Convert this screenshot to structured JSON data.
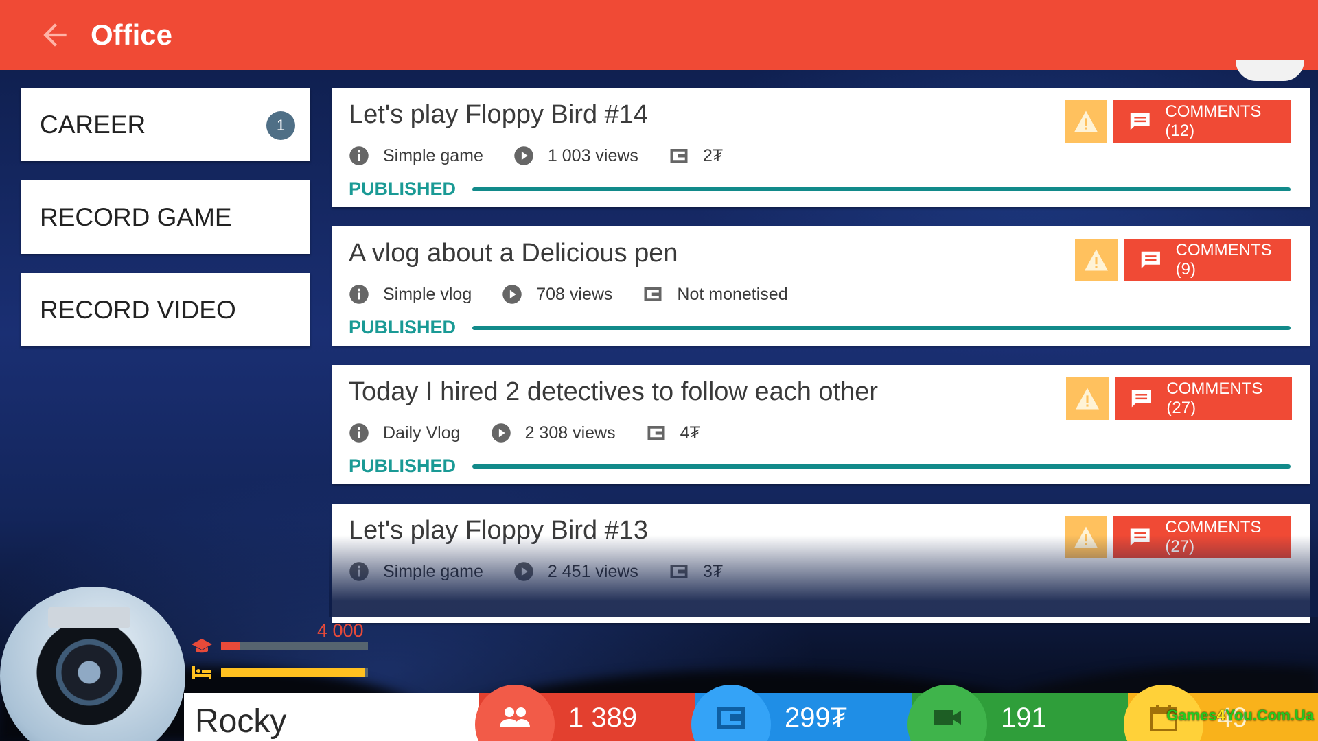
{
  "header": {
    "title": "Office"
  },
  "menu": {
    "items": [
      {
        "label": "CAREER",
        "badge": "1"
      },
      {
        "label": "RECORD GAME"
      },
      {
        "label": "RECORD VIDEO"
      }
    ]
  },
  "videos": [
    {
      "title": "Let's play Floppy Bird #14",
      "category": "Simple game",
      "views": "1 003 views",
      "earnings": "2₮",
      "status": "PUBLISHED",
      "comments": "COMMENTS (12)"
    },
    {
      "title": "A vlog about a Delicious pen",
      "category": "Simple vlog",
      "views": "708 views",
      "earnings": "Not monetised",
      "status": "PUBLISHED",
      "comments": "COMMENTS (9)"
    },
    {
      "title": "Today I hired 2 detectives to follow each other",
      "category": "Daily Vlog",
      "views": "2 308 views",
      "earnings": "4₮",
      "status": "PUBLISHED",
      "comments": "COMMENTS (27)"
    },
    {
      "title": "Let's play Floppy Bird #13",
      "category": "Simple game",
      "views": "2 451 views",
      "earnings": "3₮",
      "status": "",
      "comments": "COMMENTS (27)"
    }
  ],
  "player": {
    "name": "Rocky",
    "xp_value": "4 000",
    "xp_fraction": 0.13,
    "energy_fraction": 0.98
  },
  "stats": {
    "fans": "1 389",
    "money": "299₮",
    "videos": "191",
    "days": "49"
  },
  "watermark": {
    "part1": "Games",
    "part2": "4",
    "part3": "You",
    "part4": ".Com.Ua"
  },
  "colors": {
    "topbar": "#f04a35",
    "published": "#1a9a95",
    "warning": "#ffc15e",
    "comments": "#f04a35",
    "fans": "#e3402f",
    "money": "#1f8ee6",
    "videos": "#2f9e3a",
    "days": "#f9b21b"
  },
  "icons": {
    "back": "arrow-left-icon",
    "info": "info-icon",
    "views": "play-circle-icon",
    "earnings": "wallet-icon",
    "warning": "warning-icon",
    "comments": "comment-icon",
    "xp": "graduation-cap-icon",
    "energy": "bed-icon",
    "fans": "people-icon",
    "money": "wallet-icon",
    "videos": "video-camera-icon",
    "days": "calendar-icon"
  }
}
